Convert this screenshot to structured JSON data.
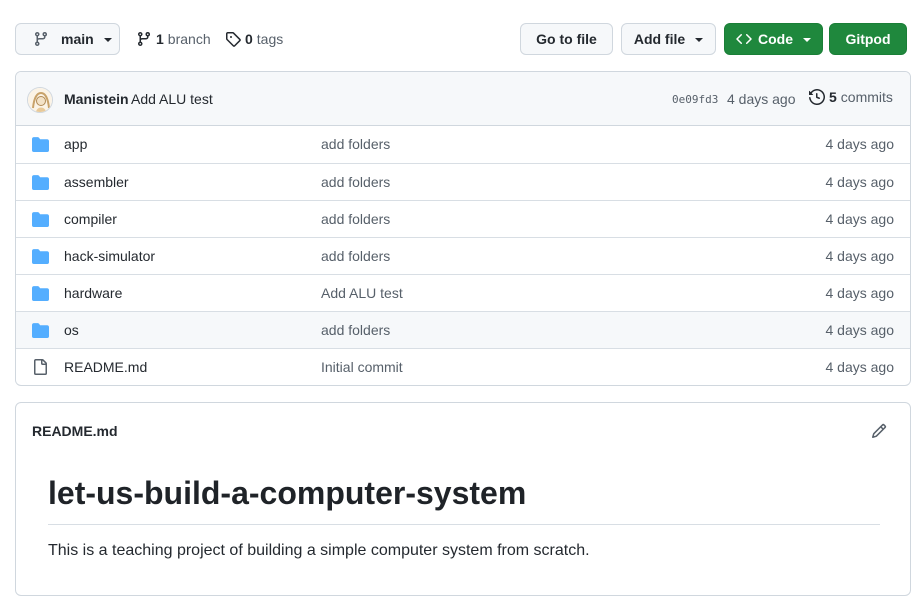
{
  "toolbar": {
    "branch_label": "main",
    "branch_count": "1",
    "branch_word": "branch",
    "tag_count": "0",
    "tag_word": "tags",
    "go_to_file": "Go to file",
    "add_file": "Add file",
    "code": "Code",
    "gitpod": "Gitpod"
  },
  "latest_commit": {
    "author": "Manistein",
    "message": "Add ALU test",
    "sha": "0e09fd3",
    "age": "4 days ago",
    "commits_count": "5",
    "commits_word": "commits"
  },
  "files": [
    {
      "name": "app",
      "type": "folder",
      "message": "add folders",
      "age": "4 days ago"
    },
    {
      "name": "assembler",
      "type": "folder",
      "message": "add folders",
      "age": "4 days ago"
    },
    {
      "name": "compiler",
      "type": "folder",
      "message": "add folders",
      "age": "4 days ago"
    },
    {
      "name": "hack-simulator",
      "type": "folder",
      "message": "add folders",
      "age": "4 days ago"
    },
    {
      "name": "hardware",
      "type": "folder",
      "message": "Add ALU test",
      "age": "4 days ago"
    },
    {
      "name": "os",
      "type": "folder",
      "message": "add folders",
      "age": "4 days ago"
    },
    {
      "name": "README.md",
      "type": "file",
      "message": "Initial commit",
      "age": "4 days ago"
    }
  ],
  "readme": {
    "filename": "README.md",
    "heading": "let-us-build-a-computer-system",
    "body": "This is a teaching project of building a simple computer system from scratch."
  },
  "colors": {
    "accent_green": "#1f883d",
    "folder_blue": "#54aeff",
    "muted_text": "#57606a",
    "border": "#d0d7de"
  }
}
